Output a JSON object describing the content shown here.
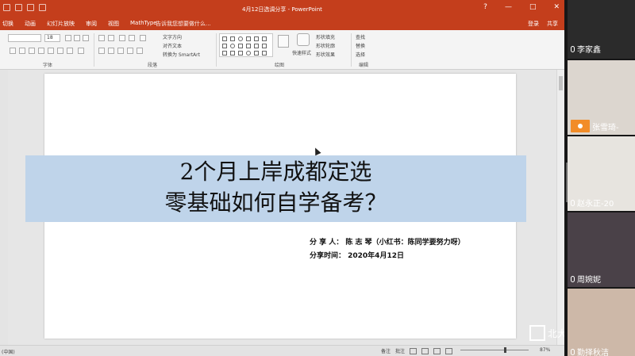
{
  "window": {
    "document_title": "4月12日选调分享 - PowerPoint",
    "controls": [
      "?",
      "—",
      "□",
      "✕"
    ]
  },
  "ribbon_tabs": [
    "切换",
    "动画",
    "幻灯片放映",
    "审阅",
    "视图",
    "MathType"
  ],
  "tell_me": "告诉我您想要做什么...",
  "account": {
    "signin": "登录",
    "share": "共享"
  },
  "ribbon": {
    "font_size": "18",
    "text_direction": "文字方向",
    "align_text": "对齐文本",
    "smartart": "转换为 SmartArt",
    "quick_styles": "快速样式",
    "shape_fill": "形状填充",
    "shape_outline": "形状轮廓",
    "shape_effects": "形状效果",
    "find": "查找",
    "replace": "替换",
    "select": "选择",
    "groups": {
      "font": "字体",
      "paragraph": "段落",
      "drawing": "绘图",
      "editing": "编辑"
    }
  },
  "slide": {
    "title_line1": "2个月上岸成都定选",
    "title_line2": "零基础如何自学备考？",
    "presenter": "分 享 人： 陈 志 琴（小红书：陈同学要努力呀）",
    "time": "分享时间： 2020年4月12日",
    "banner_color": "#bfd4ea"
  },
  "statusbar": {
    "language": "(中国)",
    "notes": "备注",
    "comments": "批注",
    "zoom": "87%"
  },
  "watermark": "北大学图书馆",
  "participants": [
    {
      "name": "李家鑫",
      "bg": "#2f2f2f"
    },
    {
      "name": "张雪琦-",
      "bg": "#dcd6cf",
      "speaking": true
    },
    {
      "name": "赵永正-20",
      "bg": "#e7e4df"
    },
    {
      "name": "周婉妮",
      "bg": "#4a4148"
    },
    {
      "name": "勤择秋洁",
      "bg": "#cdb8a8"
    }
  ],
  "colors": {
    "accent": "#c43e1c",
    "speaking": "#f28c28"
  }
}
